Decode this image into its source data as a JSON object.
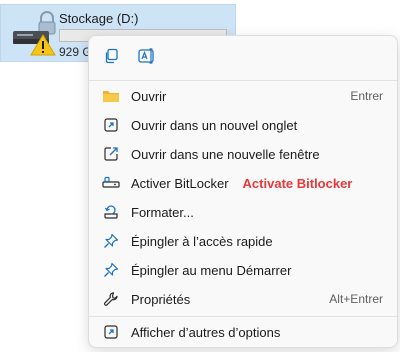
{
  "drive": {
    "name": "Stockage (D:)",
    "size_text": "929 Go",
    "icon": "drive-warning-icon"
  },
  "menu": {
    "quick_actions": [
      {
        "name": "copy",
        "icon": "copy-icon"
      },
      {
        "name": "rename",
        "icon": "rename-icon"
      }
    ],
    "items": [
      {
        "label": "Ouvrir",
        "shortcut": "Entrer",
        "icon": "folder-icon"
      },
      {
        "label": "Ouvrir dans un nouvel onglet",
        "shortcut": "",
        "icon": "new-tab-icon"
      },
      {
        "label": "Ouvrir dans une nouvelle fenêtre",
        "shortcut": "",
        "icon": "new-window-icon"
      },
      {
        "label": "Activer BitLocker",
        "shortcut": "",
        "icon": "bitlocker-key-icon",
        "annotation": "Activate Bitlocker"
      },
      {
        "label": "Formater...",
        "shortcut": "",
        "icon": "format-icon"
      },
      {
        "label": "Épingler à l’accès rapide",
        "shortcut": "",
        "icon": "pin-icon"
      },
      {
        "label": "Épingler au menu Démarrer",
        "shortcut": "",
        "icon": "pin-icon"
      },
      {
        "label": "Propriétés",
        "shortcut": "Alt+Entrer",
        "icon": "wrench-icon"
      },
      {
        "label": "Afficher d’autres d’options",
        "shortcut": "",
        "icon": "more-options-icon"
      }
    ]
  },
  "colors": {
    "accent": "#1a73c8",
    "annotation": "#e8383a",
    "tile_bg": "#cde3f6"
  }
}
